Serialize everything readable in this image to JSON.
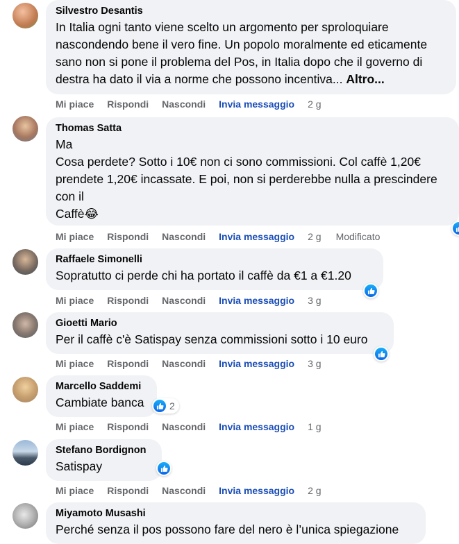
{
  "actions": {
    "like": "Mi piace",
    "reply": "Rispondi",
    "hide": "Nascondi",
    "message": "Invia messaggio"
  },
  "comments": [
    {
      "author": "Silvestro Desantis",
      "text": "In Italia ogni tanto viene scelto un argomento per sproloquiare nascondendo bene il vero fine. Un popolo moralmente ed eticamente sano non si pone il problema del Pos, in Italia dopo che il governo di destra ha dato il via a norme che possono incentiva...",
      "more": "Altro...",
      "time": "2 g"
    },
    {
      "author": "Thomas Satta",
      "line1": "Ma",
      "line2": "Cosa perdete? Sotto i 10€ non ci sono commissioni. Col caffè 1,20€ prendete 1,20€ incassate. E poi, non si perderebbe nulla a prescindere con il",
      "line3": "Caffè😂",
      "time": "2 g",
      "edited": "Modificato"
    },
    {
      "author": "Raffaele Simonelli",
      "text": "Sopratutto ci perde chi ha portato il caffè da €1 a €1.20",
      "time": "3 g"
    },
    {
      "author": "Gioetti Mario",
      "text": "Per il caffè c'è Satispay senza commissioni sotto i 10 euro",
      "time": "3 g"
    },
    {
      "author": "Marcello Saddemi",
      "text": "Cambiate banca",
      "reactions": "2",
      "time": "1 g"
    },
    {
      "author": "Stefano Bordignon",
      "text": "Satispay",
      "time": "2 g"
    },
    {
      "author": "Miyamoto Musashi",
      "text": "Perché senza il pos possono fare del nero è l’unica spiegazione"
    }
  ]
}
